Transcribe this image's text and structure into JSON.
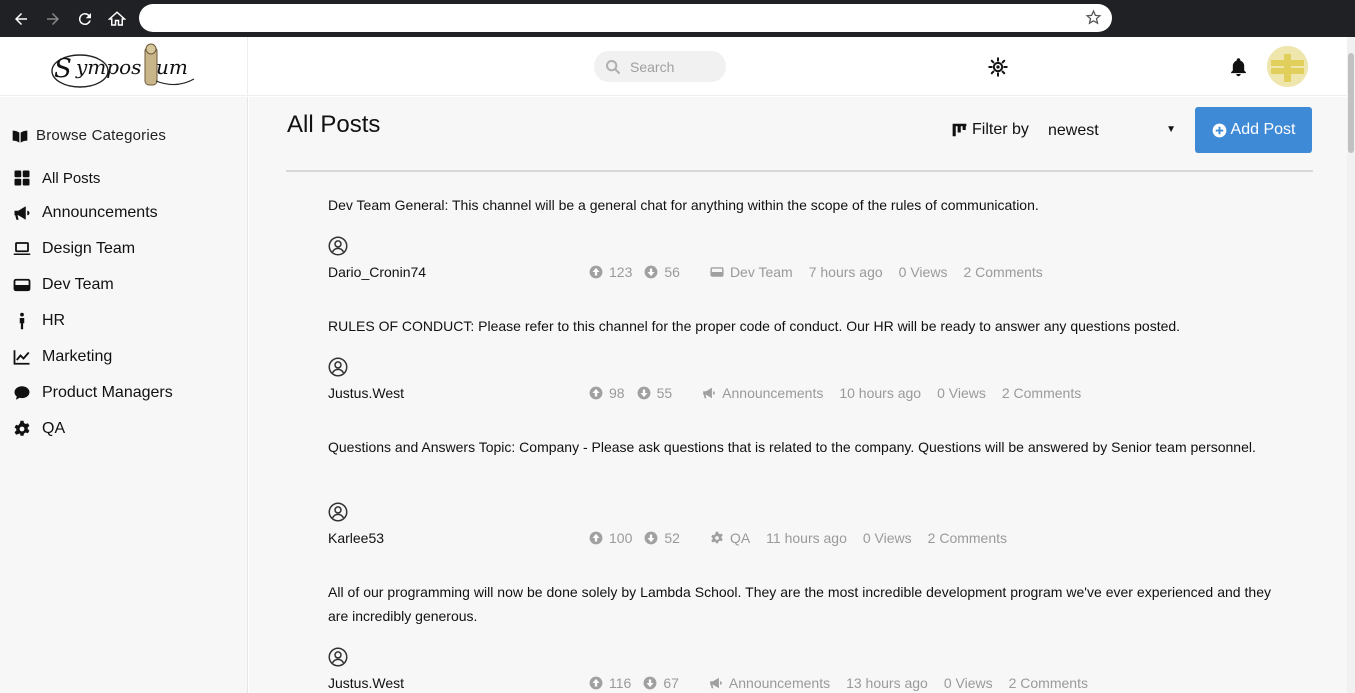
{
  "browser": {
    "address_value": ""
  },
  "header": {
    "logo_text": "Symposium",
    "search_placeholder": "Search"
  },
  "sidebar": {
    "heading": "Browse Categories",
    "items": [
      {
        "label": "All Posts",
        "icon": "grid-icon"
      },
      {
        "label": "Announcements",
        "icon": "megaphone-icon"
      },
      {
        "label": "Design Team",
        "icon": "laptop-icon"
      },
      {
        "label": "Dev Team",
        "icon": "hdd-icon"
      },
      {
        "label": "HR",
        "icon": "person-icon"
      },
      {
        "label": "Marketing",
        "icon": "chart-line-icon"
      },
      {
        "label": "Product Managers",
        "icon": "comment-icon"
      },
      {
        "label": "QA",
        "icon": "gear-icon"
      }
    ]
  },
  "main": {
    "title": "All Posts",
    "filter_label": "Filter by",
    "filter_value": "newest",
    "add_post_label": "Add Post",
    "accent_color": "#3f8ad6"
  },
  "posts": [
    {
      "text": "Dev Team General: This channel will be a general chat for anything within the scope of the rules of communication.",
      "user": "Dario_Cronin74",
      "upvotes": "123",
      "downvotes": "56",
      "category": "Dev Team",
      "time": "7 hours ago",
      "views": "0 Views",
      "comments": "2 Comments"
    },
    {
      "text": "RULES OF CONDUCT: Please refer to this channel for the proper code of conduct. Our HR will be ready to answer any questions posted.",
      "user": "Justus.West",
      "upvotes": "98",
      "downvotes": "55",
      "category": "Announcements",
      "time": "10 hours ago",
      "views": "0 Views",
      "comments": "2 Comments"
    },
    {
      "text": "Questions and Answers Topic: Company - Please ask questions that is related to the company. Questions will be answered by Senior team personnel.",
      "user": "Karlee53",
      "upvotes": "100",
      "downvotes": "52",
      "category": "QA",
      "time": "11 hours ago",
      "views": "0 Views",
      "comments": "2 Comments"
    },
    {
      "text": "All of our programming will now be done solely by Lambda School. They are the most incredible development program we've ever experienced and they are incredibly generous.",
      "user": "Justus.West",
      "upvotes": "116",
      "downvotes": "67",
      "category": "Announcements",
      "time": "13 hours ago",
      "views": "0 Views",
      "comments": "2 Comments"
    }
  ]
}
